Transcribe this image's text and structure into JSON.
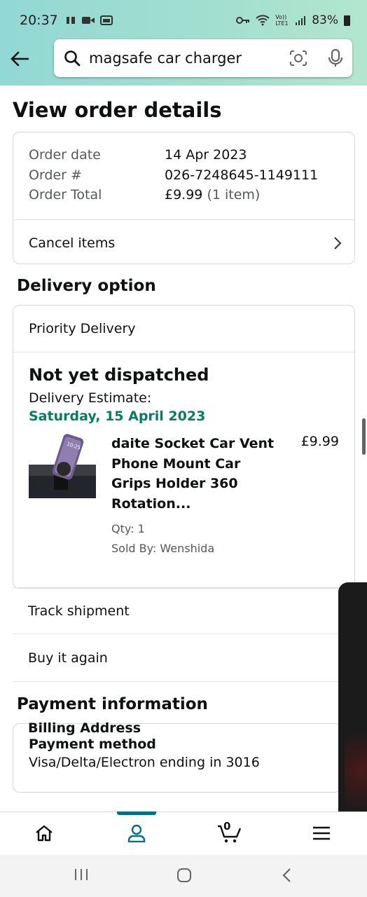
{
  "status_bar": {
    "time": "20:37",
    "volte_label": "Vo)) LTE1",
    "battery": "83%"
  },
  "search": {
    "query": "magsafe car charger"
  },
  "page": {
    "title": "View order details"
  },
  "order_summary": {
    "rows": [
      {
        "label": "Order date",
        "value": "14 Apr 2023"
      },
      {
        "label": "Order #",
        "value": "026-7248645-1149111"
      },
      {
        "label": "Order Total",
        "value": "£9.99",
        "extra": "(1 item)"
      }
    ],
    "cancel_label": "Cancel items"
  },
  "delivery": {
    "section_title": "Delivery option",
    "option": "Priority Delivery",
    "status": "Not yet dispatched",
    "estimate_label": "Delivery Estimate:",
    "estimate_date": "Saturday, 15 April 2023",
    "item": {
      "title_lines": [
        "daite Socket Car Vent",
        "Phone Mount Car",
        "Grips Holder 360",
        "Rotation..."
      ],
      "qty": "Qty: 1",
      "sold_by": "Sold By: Wenshida",
      "price": "£9.99"
    },
    "track_label": "Track shipment",
    "buy_again_label": "Buy it again"
  },
  "payment": {
    "section_title": "Payment information",
    "method_title": "Payment method",
    "method_value": "Visa/Delta/Electron ending in 3016",
    "next_partial": "Billing Address"
  },
  "bottom_nav": {
    "cart_count": "0",
    "active": "account"
  },
  "colors": {
    "header_gradient_start": "#92d8d4",
    "header_gradient_end": "#b3e6cf",
    "estimate_green": "#067d62",
    "active_teal": "#007185"
  }
}
